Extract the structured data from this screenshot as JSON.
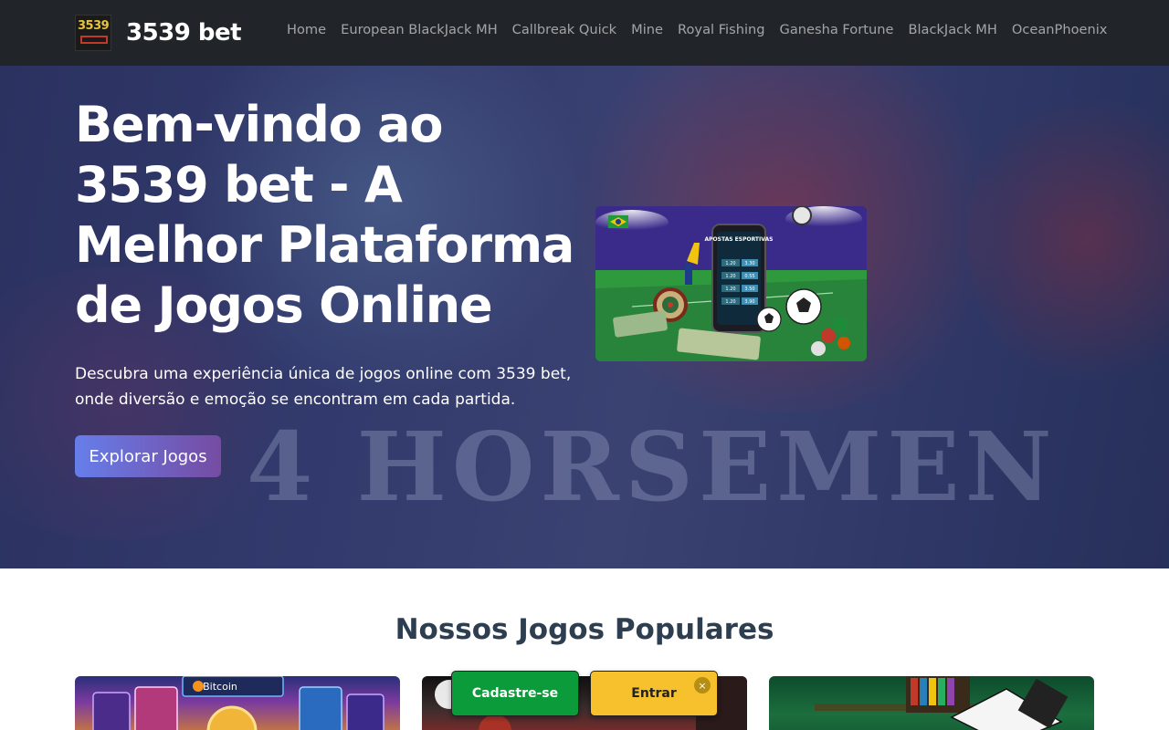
{
  "brand": {
    "logo_text": "3539",
    "name": "3539 bet"
  },
  "nav": {
    "links": [
      "Home",
      "European BlackJack MH",
      "Callbreak Quick",
      "Mine",
      "Royal Fishing",
      "Ganesha Fortune",
      "BlackJack MH",
      "OceanPhoenix"
    ]
  },
  "hero": {
    "title": "Bem-vindo ao 3539 bet - A Melhor Plataforma de Jogos Online",
    "description": "Descubra uma experiência única de jogos online com 3539 bet, onde diversão e emoção se encontram em cada partida.",
    "cta_label": "Explorar Jogos",
    "watermark": "4 HORSEMEN",
    "image_text": "APOSTAS ESPORTIVAS",
    "image_odds": [
      "1.20",
      "3.30",
      "1.20",
      "0.55",
      "1.20",
      "3.50",
      "1.20",
      "3.90"
    ]
  },
  "popular": {
    "title": "Nossos Jogos Populares",
    "card1_text": "Bitcoin"
  },
  "floating": {
    "signup_label": "Cadastre-se",
    "login_label": "Entrar",
    "close_symbol": "×"
  },
  "colors": {
    "navbar_bg": "#212529",
    "cta_gradient_start": "#667eea",
    "cta_gradient_end": "#764ba2",
    "signup_bg": "#0c9b3a",
    "login_bg": "#f6c12d",
    "section_title": "#2c3e50"
  }
}
